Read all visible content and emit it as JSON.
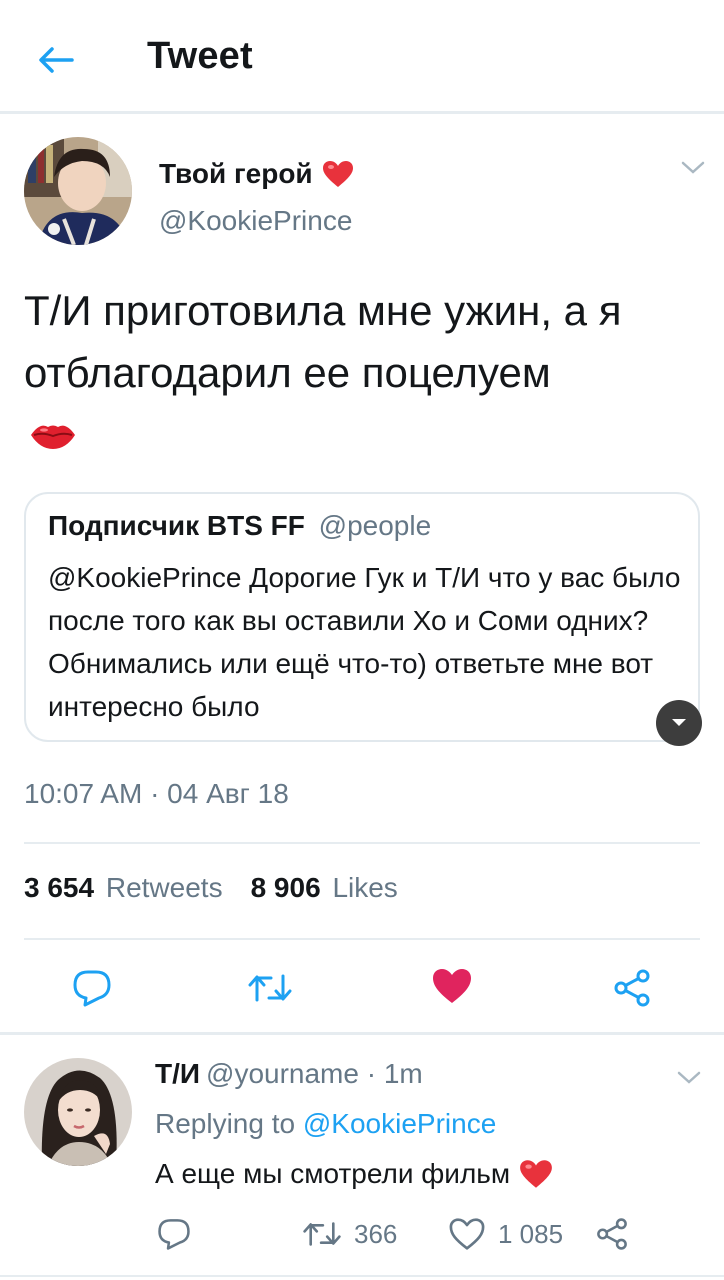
{
  "header": {
    "title": "Tweet"
  },
  "main_tweet": {
    "author_name": "Твой герой",
    "author_handle": "@KookiePrince",
    "text": "Т/И приготовила мне ужин, а я отблагодарил ее поцелуем",
    "quoted": {
      "name": "Подписчик BTS FF",
      "handle": "@people",
      "text": "@KookiePrince Дорогие Гук и Т/И что у вас было после того как вы оставили Хо и Соми одних? Обнимались или ещё что-то) ответьте мне вот интересно было"
    },
    "timestamp": "10:07 AM · 04 Авг 18",
    "retweets_count": "3 654",
    "retweets_label": "Retweets",
    "likes_count": "8 906",
    "likes_label": "Likes"
  },
  "reply_tweet": {
    "author_name": "Т/И",
    "meta": "@yourname · 1m",
    "replying_prefix": "Replying to",
    "replying_handle": "@KookiePrince",
    "text": "А еще мы смотрели фильм",
    "retweets_count": "366",
    "likes_count": "1 085"
  },
  "colors": {
    "accent": "#1da1f2",
    "like_active": "#e0245e",
    "secondary_text": "#657786",
    "divider": "#e6ecf0"
  },
  "icons": [
    "back-arrow-icon",
    "heart-emoji-icon",
    "lips-emoji-icon",
    "chevron-down-icon",
    "reply-icon",
    "retweet-icon",
    "like-icon",
    "share-icon"
  ]
}
